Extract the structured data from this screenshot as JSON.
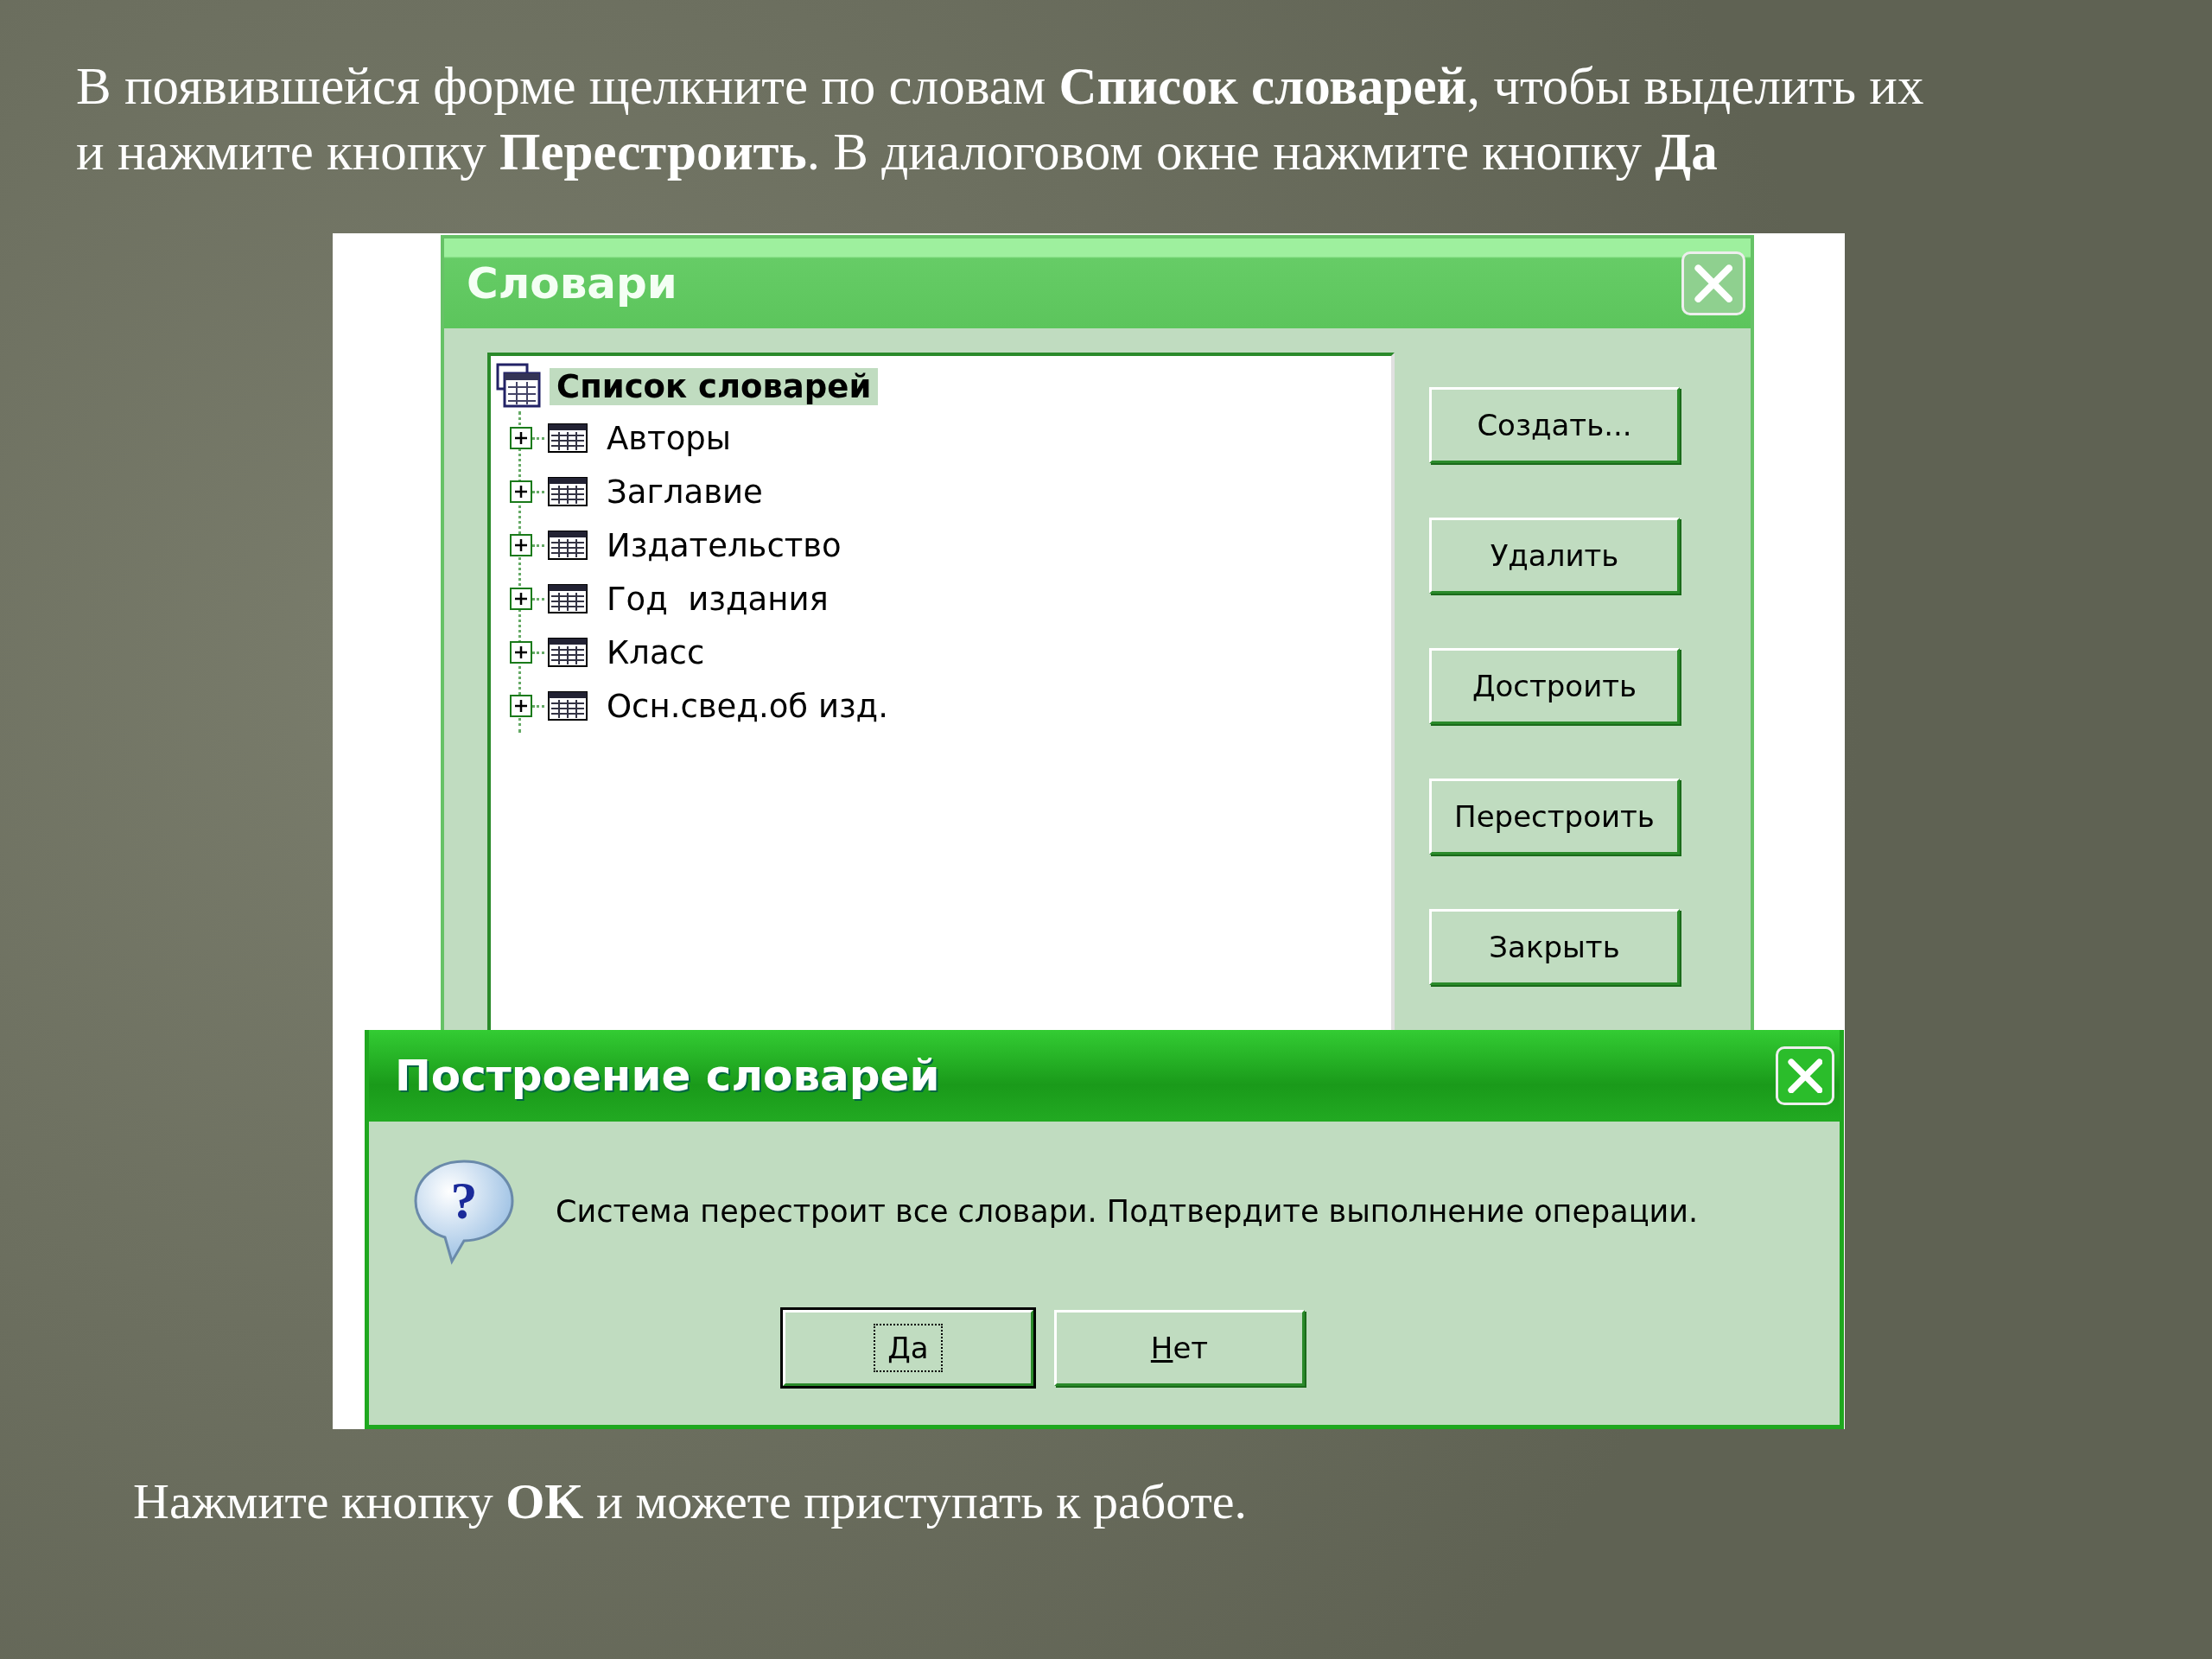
{
  "instruction": {
    "lines": [
      "В появившейся форме щелкните по словам **Список словарей**, чтобы выделить их",
      "и нажмите кнопку **Перестроить**. В диалоговом окне нажмите кнопку **Да**"
    ]
  },
  "dictionaries_window": {
    "title": "Словари",
    "tree": {
      "label": "Список словарей",
      "selected": true,
      "expanded": true,
      "children": [
        {
          "label": "Авторы",
          "expanded": false
        },
        {
          "label": "Заглавие",
          "expanded": false
        },
        {
          "label": "Издательство",
          "expanded": false
        },
        {
          "label": "Год  издания",
          "expanded": false
        },
        {
          "label": "Класс",
          "expanded": false
        },
        {
          "label": "Осн.свед.об изд.",
          "expanded": false
        }
      ]
    },
    "buttons": [
      "Создать...",
      "Удалить",
      "Достроить",
      "Перестроить",
      "Закрыть"
    ]
  },
  "confirm_dialog": {
    "title": "Построение словарей",
    "icon_glyph": "?",
    "message": "Система перестроит все словари. Подтвердите выполнение операции.",
    "buttons": [
      {
        "label": "Да",
        "default": true,
        "mnemonic": true
      },
      {
        "label": "Нет",
        "default": false,
        "mnemonic": true
      }
    ]
  },
  "footer": {
    "text": "Нажмите кнопку **OK** и можете приступать к работе."
  }
}
